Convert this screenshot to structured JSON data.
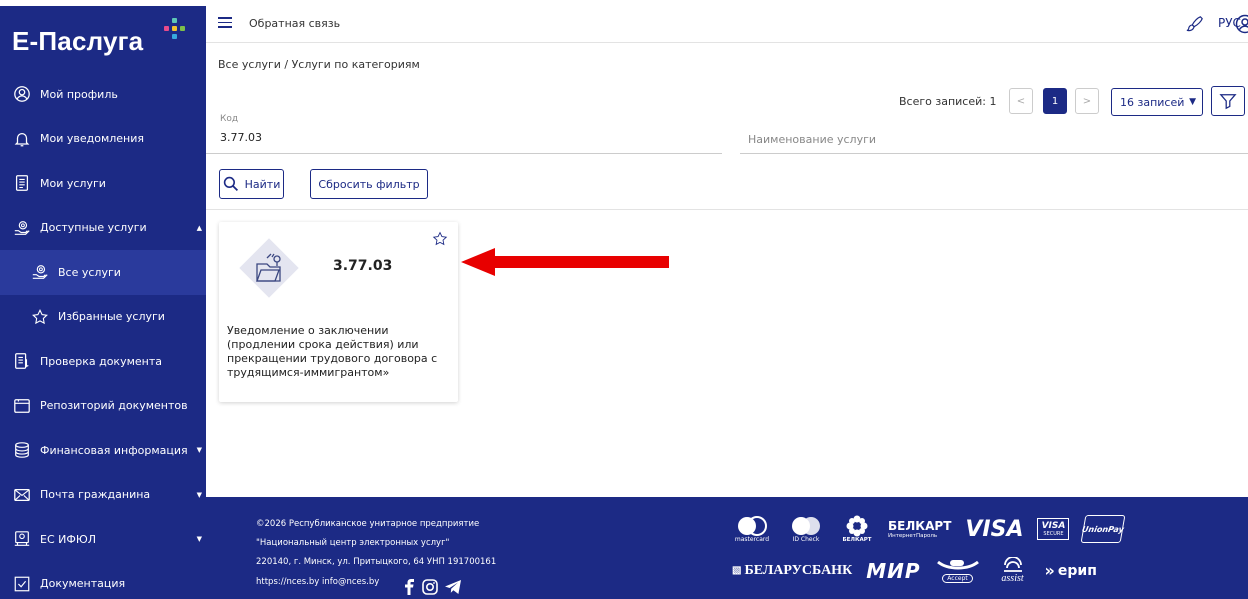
{
  "sidebar": {
    "logo": "Е-Паслуга",
    "items": [
      {
        "label": "Мой профиль",
        "icon": "user-circle-icon"
      },
      {
        "label": "Мои уведомления",
        "icon": "bell-icon"
      },
      {
        "label": "Мои услуги",
        "icon": "document-list-icon"
      },
      {
        "label": "Доступные услуги",
        "icon": "services-icon"
      },
      {
        "label": "Все услуги",
        "icon": "services-icon"
      },
      {
        "label": "Избранные услуги",
        "icon": "star-icon"
      },
      {
        "label": "Проверка документа",
        "icon": "document-check-icon"
      },
      {
        "label": "Репозиторий документов",
        "icon": "folder-icon"
      },
      {
        "label": "Финансовая информация",
        "icon": "database-icon"
      },
      {
        "label": "Почта гражданина",
        "icon": "mail-icon"
      },
      {
        "label": "ЕС ИФЮЛ",
        "icon": "registry-icon"
      },
      {
        "label": "Документация",
        "icon": "checkbox-icon"
      }
    ]
  },
  "header": {
    "feedback": "Обратная связь",
    "lang": "РУС"
  },
  "breadcrumb": "Все услуги / Услуги по категориям",
  "pagination": {
    "total_label": "Всего записей: 1",
    "prev": "<",
    "page": "1",
    "next": ">",
    "per_page": "16 записей"
  },
  "filter": {
    "code_label": "Код",
    "code_value": "3.77.03",
    "name_placeholder": "Наименование услуги",
    "find_label": "Найти",
    "reset_label": "Сбросить фильтр"
  },
  "card": {
    "code": "3.77.03",
    "description": "Уведомление о заключении (продлении срока действия) или прекращении трудового договора с трудящимся-иммигрантом»"
  },
  "footer": {
    "line1": "©2026 Республиканское унитарное предприятие",
    "line2": "\"Национальный центр электронных услуг\"",
    "line3": "220140, г. Минск, ул. Притыцкого, 64  УНП 191700161",
    "line4": "https://nces.by  info@nces.by",
    "payment_logos": {
      "mastercard": "mastercard",
      "idcheck": "ID Check",
      "belkart_small": "БЕЛКАРТ",
      "belkart": "БЕЛКАРТ",
      "belkart_sub": "ИнтернетПароль",
      "visa": "VISA",
      "visa_secure_1": "VISA",
      "visa_secure_2": "SECURE",
      "unionpay": "UnionPay",
      "belarusbank": "БЕЛАРУСБАНК",
      "mir": "МИР",
      "mir_accept": "Accept",
      "assist": "assist",
      "erip": "ерип"
    }
  },
  "colors": {
    "primary": "#1c2a85",
    "sub_active": "#2a3a9c",
    "arrow": "#e80000"
  }
}
